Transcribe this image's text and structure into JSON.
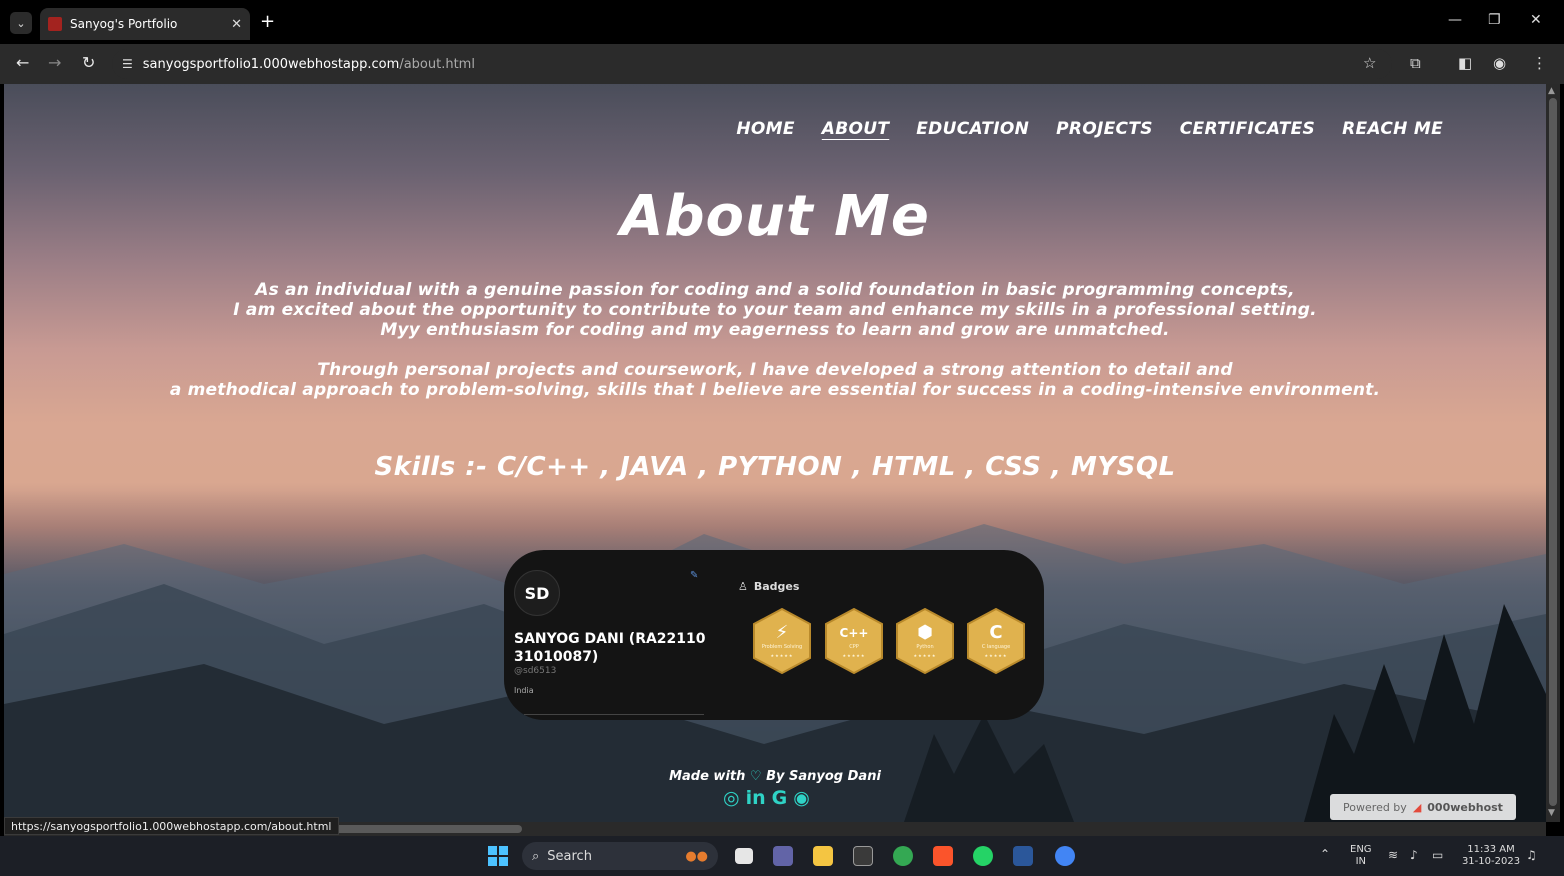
{
  "browser": {
    "tab_title": "Sanyog's Portfolio",
    "url_host": "sanyogsportfolio1.000webhostapp.com",
    "url_path": "/about.html",
    "status_url": "https://sanyogsportfolio1.000webhostapp.com/about.html"
  },
  "nav": {
    "items": [
      "HOME",
      "ABOUT",
      "EDUCATION",
      "PROJECTS",
      "CERTIFICATES",
      "REACH ME"
    ],
    "active": "ABOUT"
  },
  "about": {
    "title": "About Me",
    "para1": [
      "As an individual with a genuine passion for coding and a solid foundation in basic programming concepts,",
      "I am excited about the opportunity to contribute to your team and enhance my skills in a professional setting.",
      "Myy enthusiasm for coding and my eagerness to learn and grow are unmatched."
    ],
    "para2": [
      "Through personal projects and coursework, I have developed a strong attention to detail and",
      "a methodical approach to problem-solving, skills that I believe are essential for success in a coding-intensive environment."
    ],
    "skills": "Skills :- C/C++ , JAVA , PYTHON , HTML , CSS , MYSQL"
  },
  "card": {
    "initials": "SD",
    "name": "SANYOG DANI (RA22110 31010087)",
    "handle": "@sd6513",
    "country": "India",
    "badges_title": "Badges",
    "badges": [
      {
        "glyph": "⚡",
        "label": "Problem Solving",
        "stars": "★★★★★"
      },
      {
        "glyph": "C++",
        "label": "CPP",
        "stars": "★★★★★"
      },
      {
        "glyph": "⬢",
        "label": "Python",
        "stars": "★★★★★"
      },
      {
        "glyph": "C",
        "label": "C language",
        "stars": "★★★★★"
      }
    ],
    "badge_color": "#e0b24e"
  },
  "footer": {
    "made_prefix": "Made with",
    "made_suffix": "By Sanyog Dani",
    "social_icons": [
      "instagram-icon",
      "linkedin-icon",
      "google-icon",
      "github-icon"
    ],
    "accent_color": "#2fd3c6"
  },
  "powered": {
    "label": "Powered by",
    "brand": "000webhost"
  },
  "taskbar": {
    "search": "Search",
    "lang": "ENG",
    "region": "IN",
    "time": "11:33 AM",
    "date": "31-10-2023"
  }
}
